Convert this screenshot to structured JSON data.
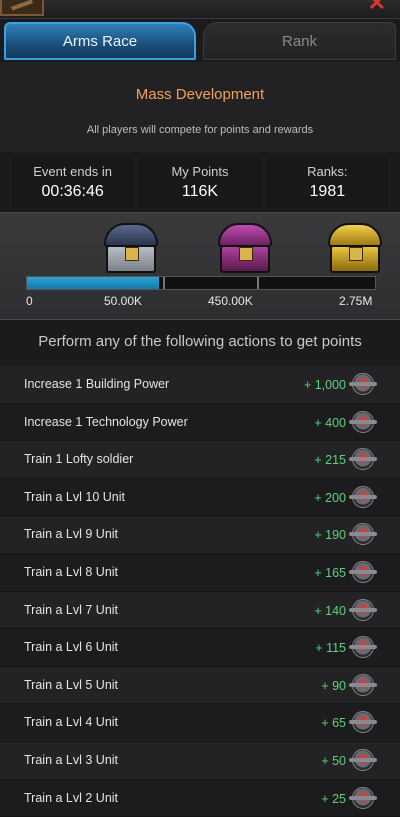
{
  "header": {
    "close_glyph": "✕"
  },
  "tabs": [
    {
      "label": "Arms Race",
      "active": true
    },
    {
      "label": "Rank",
      "active": false
    }
  ],
  "event": {
    "name": "Mass Development",
    "subtitle": "All players will compete for points and rewards"
  },
  "stats": {
    "ends_label": "Event ends in",
    "ends_value": "00:36:46",
    "points_label": "My Points",
    "points_value": "116K",
    "ranks_label": "Ranks:",
    "ranks_value": "1981"
  },
  "rewards": {
    "chests": [
      {
        "icon": "silver-chest-icon",
        "color": "#9aa3b5"
      },
      {
        "icon": "purple-chest-icon",
        "color": "#b03fa0"
      },
      {
        "icon": "gold-chest-icon",
        "color": "#e8c63c"
      }
    ],
    "milestones": [
      "0",
      "50.00K",
      "450.00K",
      "2.75M"
    ],
    "progress_fraction": 0.38,
    "fill_color": "#2aa3d8"
  },
  "actions": {
    "heading": "Perform any of the following actions to get points",
    "points_color": "#5ed07a",
    "rows": [
      {
        "label": "Increase 1 Building Power",
        "points": "+ 1,000"
      },
      {
        "label": "Increase 1 Technology Power",
        "points": "+ 400"
      },
      {
        "label": "Train 1 Lofty soldier",
        "points": "+ 215"
      },
      {
        "label": "Train a Lvl 10 Unit",
        "points": "+ 200"
      },
      {
        "label": "Train a Lvl 9 Unit",
        "points": "+ 190"
      },
      {
        "label": "Train a Lvl 8 Unit",
        "points": "+ 165"
      },
      {
        "label": "Train a Lvl 7 Unit",
        "points": "+ 140"
      },
      {
        "label": "Train a Lvl 6 Unit",
        "points": "+ 115"
      },
      {
        "label": "Train a Lvl 5 Unit",
        "points": "+ 90"
      },
      {
        "label": "Train a Lvl 4 Unit",
        "points": "+ 65"
      },
      {
        "label": "Train a Lvl 3 Unit",
        "points": "+ 50"
      },
      {
        "label": "Train a Lvl 2 Unit",
        "points": "+ 25"
      }
    ]
  }
}
